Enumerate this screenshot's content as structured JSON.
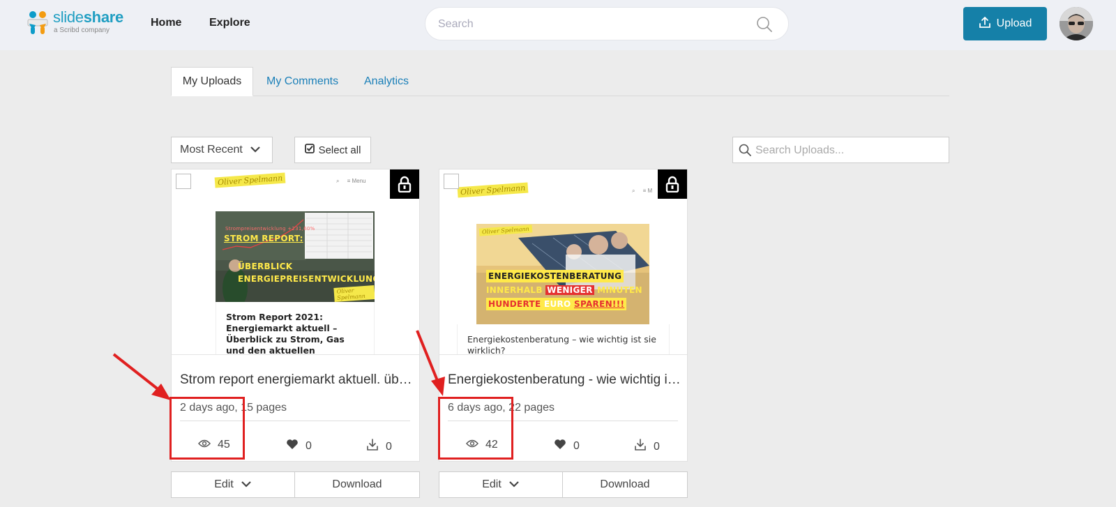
{
  "header": {
    "logo_word_light": "slide",
    "logo_word_bold": "share",
    "logo_sub": "a Scribd company",
    "nav": [
      {
        "label": "Home"
      },
      {
        "label": "Explore"
      }
    ],
    "search_placeholder": "Search",
    "upload_label": "Upload"
  },
  "tabs": [
    {
      "label": "My Uploads",
      "active": true
    },
    {
      "label": "My Comments",
      "active": false
    },
    {
      "label": "Analytics",
      "active": false
    }
  ],
  "toolbar": {
    "sort_value": "Most Recent",
    "select_all_label": "Select all",
    "search_placeholder": "Search Uploads..."
  },
  "colors": {
    "accent": "#1580a8",
    "link": "#1a7fb8",
    "annotation": "#e02020"
  },
  "cards": [
    {
      "title": "Strom report energiemarkt aktuell. überblick strom, gas und den aktuellen",
      "meta": "2 days ago, 15 pages",
      "views": "45",
      "likes": "0",
      "downloads": "0",
      "edit_label": "Edit",
      "download_label": "Download",
      "thumb": {
        "signature": "Oliver Spelmann",
        "mini_nav": "Menu",
        "chart_caption": "Strompreisentwicklung +231,60%",
        "banner_lines": [
          "STROM REPORT:",
          "ÜBERBLICK",
          "ENERGIEPREISENTWICKLUNG"
        ],
        "doc_title": "Strom Report 2021: Energiemarkt aktuell – Überblick zu Strom, Gas und den aktuellen"
      }
    },
    {
      "title": "Energiekostenberatung - wie wichtig ist sie wirklich?",
      "meta": "6 days ago, 22 pages",
      "views": "42",
      "likes": "0",
      "downloads": "0",
      "edit_label": "Edit",
      "download_label": "Download",
      "thumb": {
        "signature": "Oliver Spelmann",
        "mini_nav": "M",
        "banner_line1": "ENERGIEKOSTENBERATUNG",
        "banner_line2_a": "INNERHALB ",
        "banner_line2_b": "WENIGER",
        "banner_line2_c": " MINUTEN",
        "banner_line3_a": "HUNDERTE",
        "banner_line3_b": " EURO ",
        "banner_line3_c": "SPAREN!!!",
        "doc_title": "Energiekostenberatung – wie wichtig ist sie wirklich?"
      }
    }
  ]
}
